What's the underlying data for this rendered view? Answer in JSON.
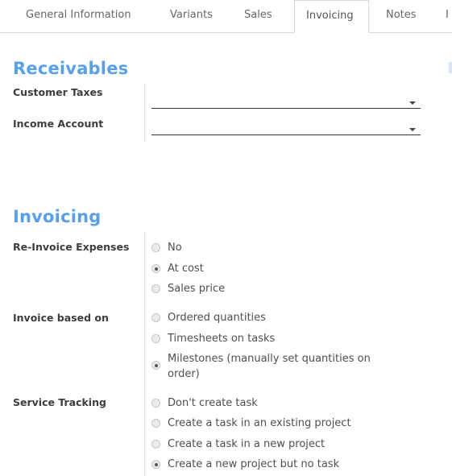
{
  "tabs": [
    {
      "label": "General Information"
    },
    {
      "label": "Variants"
    },
    {
      "label": "Sales"
    },
    {
      "label": "Invoicing",
      "active": true
    },
    {
      "label": "Notes"
    },
    {
      "label": "I"
    }
  ],
  "receivables": {
    "title": "Receivables",
    "customer_taxes_label": "Customer Taxes",
    "customer_taxes_value": "",
    "income_account_label": "Income Account",
    "income_account_value": ""
  },
  "invoicing": {
    "title": "Invoicing",
    "reinvoice_label": "Re-Invoice Expenses",
    "reinvoice_options": [
      {
        "label": "No",
        "checked": false
      },
      {
        "label": "At cost",
        "checked": true
      },
      {
        "label": "Sales price",
        "checked": false
      }
    ],
    "invoice_based_label": "Invoice based on",
    "invoice_based_options": [
      {
        "label": "Ordered quantities",
        "checked": false
      },
      {
        "label": "Timesheets on tasks",
        "checked": false
      },
      {
        "label": "Milestones (manually set quantities on",
        "label2": "order)",
        "checked": true
      }
    ],
    "service_tracking_label": "Service Tracking",
    "service_tracking_options": [
      {
        "label": "Don't create task",
        "checked": false
      },
      {
        "label": "Create a task in an existing project",
        "checked": false
      },
      {
        "label": "Create a task in a new project",
        "checked": false
      },
      {
        "label": "Create a new project but no task",
        "checked": true
      }
    ]
  },
  "colors": {
    "accent": "#5aa0e6",
    "text": "#4c4c4c"
  }
}
